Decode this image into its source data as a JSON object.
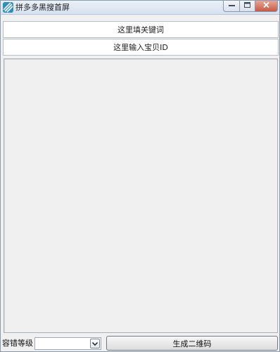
{
  "window": {
    "title": "拼多多黑搜首屏",
    "icon": "app-logo-icon",
    "controls": {
      "minimize": "minimize-icon",
      "maximize": "maximize-icon",
      "close": "close-icon"
    }
  },
  "form": {
    "keyword_placeholder": "这里填关键词",
    "keyword_value": "",
    "item_id_placeholder": "这里输入宝贝ID",
    "item_id_value": ""
  },
  "output": {
    "content": ""
  },
  "footer": {
    "tolerance_label": "容错等级：",
    "tolerance_value": "",
    "generate_button": "生成二维码"
  },
  "colors": {
    "background": "#f0f0f0",
    "close_button": "#c75a45",
    "titlebar": "#d6e1ef"
  }
}
